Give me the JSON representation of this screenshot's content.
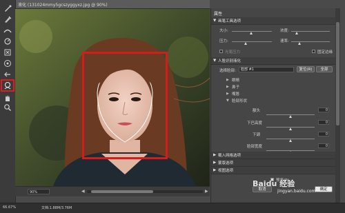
{
  "window": {
    "title": "液化 (131024mmy5gcszyggyxz.jpg @ 90%)"
  },
  "tools": [
    {
      "name": "forward-warp-tool-icon"
    },
    {
      "name": "reconstruct-tool-icon"
    },
    {
      "name": "smooth-tool-icon"
    },
    {
      "name": "twirl-tool-icon"
    },
    {
      "name": "pucker-tool-icon"
    },
    {
      "name": "bloat-tool-icon"
    },
    {
      "name": "push-left-tool-icon"
    },
    {
      "name": "freeze-mask-tool-icon"
    },
    {
      "name": "thaw-mask-tool-icon"
    },
    {
      "name": "face-tool-icon",
      "active": true
    },
    {
      "name": "hand-tool-icon"
    },
    {
      "name": "zoom-tool-icon"
    }
  ],
  "canvas": {
    "zoom": "90%",
    "highlight_color": "#d41c1c"
  },
  "status": {
    "zoom": "66.67%",
    "doc": "文档:1.88M/3.76M"
  },
  "panel": {
    "title": "属性",
    "brush_section": {
      "header": "画笔工具选项",
      "size_label": "大小:",
      "density_label": "浓度:",
      "pressure_label": "压力:",
      "rate_label": "速率:",
      "stylus_label": "光笔压力",
      "pin_edges_label": "固定边缘"
    },
    "face_section": {
      "header": "人脸识别液化",
      "select_face_label": "选择脸部:",
      "select_face_value": "脸部 #1",
      "reset_label": "复位(R)",
      "all_label": "全部",
      "eyes": "眼睛",
      "nose": "鼻子",
      "mouth": "嘴唇",
      "face_shape": "脸部形状",
      "forehead_label": "额头",
      "forehead_value": "0",
      "chin_height_label": "下巴高度",
      "chin_height_value": "0",
      "jawline_label": "下颌",
      "jawline_value": "0",
      "face_width_label": "脸部宽度",
      "face_width_value": "0"
    },
    "collapsed_sections": [
      "载入网格选项",
      "蒙版选项",
      "视图选项"
    ],
    "preview_label": "预览(P)",
    "cancel_label": "取消",
    "ok_label": "确定"
  },
  "watermark": {
    "brand": "Baidu 经验",
    "url": "jingyan.baidu.com"
  }
}
